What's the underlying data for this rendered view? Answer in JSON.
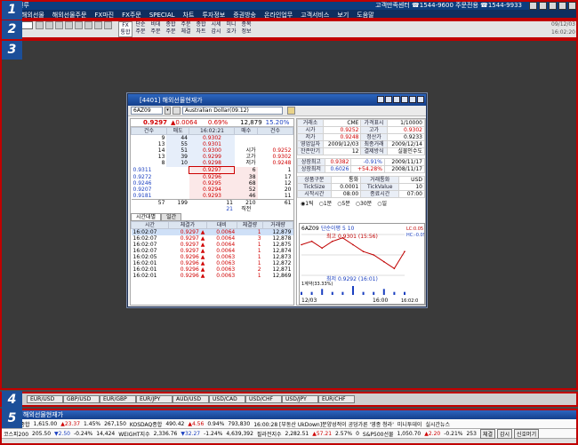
{
  "app": {
    "title": "원루",
    "center_tel": "고객만족센터 ☎1544-9600  주문전용 ☎1544-9933",
    "menu": [
      "해외선물",
      "해외선물주문",
      "FX마진",
      "FX주문",
      "SPECIAL",
      "차트",
      "투자정보",
      "증권방송",
      "온라인업무",
      "고객서비스",
      "보기",
      "도움말"
    ]
  },
  "toolbar": {
    "buttons": [
      {
        "top": "FX",
        "bottom": "통합"
      },
      {
        "top": "단순",
        "bottom": "주문"
      },
      {
        "top": "비데",
        "bottom": "주문"
      },
      {
        "top": "종합",
        "bottom": "주문"
      },
      {
        "top": "주문",
        "bottom": "체결"
      },
      {
        "top": "종합",
        "bottom": "차트"
      },
      {
        "top": "시세",
        "bottom": "감시"
      },
      {
        "top": "미니",
        "bottom": "호가"
      },
      {
        "top": "종목",
        "bottom": "정보"
      }
    ],
    "date": "09/12/03",
    "time": "16:02:20"
  },
  "zones": [
    "1",
    "2",
    "3",
    "4",
    "5"
  ],
  "window": {
    "title": "[4401] 해외선물현재가",
    "symbol": "6AZ09",
    "symbol_name": "Australian Dollar(09.12)",
    "summary": {
      "price": "0.9297",
      "arrow": "▲",
      "change": "0.0064",
      "rate": "0.69%",
      "volume": "12,879",
      "pct": "15.20%"
    },
    "quote_headers": [
      "건수",
      "매도",
      "16:02:21",
      "매수",
      "건수"
    ],
    "asks": [
      {
        "cnt": "9",
        "qty": "44",
        "price": "0.9302"
      },
      {
        "cnt": "13",
        "qty": "55",
        "price": "0.9301"
      },
      {
        "cnt": "14",
        "qty": "51",
        "price": "0.9300"
      },
      {
        "cnt": "13",
        "qty": "39",
        "price": "0.9299"
      },
      {
        "cnt": "8",
        "qty": "10",
        "price": "0.9298"
      }
    ],
    "ask_side_labels": [
      {
        "label": "",
        "value": ""
      },
      {
        "label": "",
        "value": ""
      },
      {
        "label": "시가",
        "value": "0.9252"
      },
      {
        "label": "고가",
        "value": "0.9302"
      },
      {
        "label": "저가",
        "value": "0.9248"
      }
    ],
    "side_prices": [
      "0.9311",
      "0.9272",
      "0.9246",
      "0.9207",
      "0.9181"
    ],
    "bids": [
      {
        "price": "0.9297",
        "qty": "6",
        "cnt": "1"
      },
      {
        "price": "0.9296",
        "qty": "38",
        "cnt": "17"
      },
      {
        "price": "0.9295",
        "qty": "68",
        "cnt": "12"
      },
      {
        "price": "0.9294",
        "qty": "52",
        "cnt": "20"
      },
      {
        "price": "0.9293",
        "qty": "46",
        "cnt": "11"
      }
    ],
    "totals": {
      "ask_cnt": "57",
      "ask_qty": "199",
      "mid": "11",
      "bid_qty": "210",
      "bid_cnt": "61"
    },
    "sub_totals": {
      "left": "21",
      "label": "직전"
    },
    "tabs": [
      "시간대별",
      "일간"
    ],
    "tick_headers": [
      "시간",
      "체결가",
      "대비",
      "체결량",
      "거래량"
    ],
    "ticks": [
      {
        "t": "16:02:07",
        "p": "0.9297",
        "d": "0.0064",
        "q": "1",
        "v": "12,879"
      },
      {
        "t": "16:02:07",
        "p": "0.9297",
        "d": "0.0064",
        "q": "3",
        "v": "12,878"
      },
      {
        "t": "16:02:07",
        "p": "0.9297",
        "d": "0.0064",
        "q": "1",
        "v": "12,875"
      },
      {
        "t": "16:02:07",
        "p": "0.9297",
        "d": "0.0064",
        "q": "1",
        "v": "12,874"
      },
      {
        "t": "16:02:05",
        "p": "0.9296",
        "d": "0.0063",
        "q": "1",
        "v": "12,873"
      },
      {
        "t": "16:02:01",
        "p": "0.9296",
        "d": "0.0063",
        "q": "1",
        "v": "12,872"
      },
      {
        "t": "16:02:01",
        "p": "0.9296",
        "d": "0.0063",
        "q": "2",
        "v": "12,871"
      },
      {
        "t": "16:02:01",
        "p": "0.9296",
        "d": "0.0063",
        "q": "1",
        "v": "12,869"
      }
    ],
    "info": [
      {
        "k1": "거래소",
        "v1": "CME",
        "k2": "가격표시",
        "v2": "1/10000"
      },
      {
        "k1": "시가",
        "v1": "0.9252",
        "k2": "고가",
        "v2": "0.9302"
      },
      {
        "k1": "저가",
        "v1": "0.9248",
        "k2": "정산가",
        "v2": "0.9233"
      },
      {
        "k1": "영업일자",
        "v1": "2009/12/03",
        "k2": "최종거래",
        "v2": "2009/12/14"
      },
      {
        "k1": "잔존만기",
        "v1": "12",
        "k2": "결제방식",
        "v2": "실물인수도"
      }
    ],
    "limits": [
      {
        "k": "상장최고",
        "v": "0.9382",
        "r": "-0.91%",
        "d": "2009/11/17"
      },
      {
        "k": "상장최저",
        "v": "0.6026",
        "r": "+54.28%",
        "d": "2008/11/17"
      }
    ],
    "spec": [
      {
        "k1": "상품구분",
        "v1": "통화",
        "k2": "거래통화",
        "v2": "USD"
      },
      {
        "k1": "TickSize",
        "v1": "0.0001",
        "k2": "TickValue",
        "v2": "10"
      },
      {
        "k1": "시작시간",
        "v1": "08:00",
        "k2": "종료시간",
        "v2": "07:00"
      }
    ],
    "periods": [
      "1틱",
      "1분",
      "5분",
      "30분",
      "일"
    ],
    "chart": {
      "symbol": "6AZ09",
      "legend": "단순이평 5  10",
      "high_label": "최고 0.9301 (15:56)",
      "low_label": "최저 0.9292 (16:01)",
      "lc": "LC:0.05",
      "hc": "HC:-0.05",
      "vol_label": "1계약(33.33%)",
      "x_start": "12/03",
      "x_mid": "16:00",
      "x_end": "16:02:0"
    }
  },
  "chart_data": {
    "type": "line",
    "x": [
      "15:52",
      "15:53",
      "15:54",
      "15:55",
      "15:56",
      "15:57",
      "15:58",
      "15:59",
      "16:00",
      "16:01",
      "16:02"
    ],
    "series": [
      {
        "values": [
          0.9299,
          0.93,
          0.9298,
          0.93,
          0.9301,
          0.9299,
          0.9297,
          0.9296,
          0.9294,
          0.9292,
          0.9297
        ]
      }
    ],
    "ylim": [
      0.929,
      0.9302
    ],
    "volume": [
      1,
      1,
      2,
      1,
      1,
      3,
      1,
      1,
      2,
      1,
      1
    ]
  },
  "ticker_tabs": [
    "EUR/USD",
    "GBP/USD",
    "EUR/GBP",
    "EUR/JPY",
    "AUD/USD",
    "USD/CAD",
    "USD/CHF",
    "USD/JPY",
    "EUR/CHF"
  ],
  "bottom_panel": {
    "title": "해외선물현재가",
    "row1": [
      "코스피 종합",
      "1,615.00",
      "▲23.37",
      "1.45%",
      "267,150",
      "KOSDAQ종합",
      "490.42",
      "▲4.56",
      "0.94%",
      "793,830",
      "16:00:28 [부동산 UkDown]분양성적이 공덩가른 '영종 청라'",
      "미니투데이",
      "실시간뉴스"
    ],
    "row2": [
      "코스피200",
      "205.50",
      "▼2.50",
      "-0.24%",
      "14,424",
      "WEIGHT지수",
      "2,336.76",
      "▼32.27",
      "-1.24%",
      "4,639,392",
      "필라전지수",
      "2,282.51",
      "▲57.21",
      "2.57%",
      "0",
      "S&P500선물",
      "1,050.70",
      "▲2.20",
      "-0.21%",
      "253"
    ],
    "buttons": [
      "체결",
      "감시",
      "신호머기"
    ]
  }
}
